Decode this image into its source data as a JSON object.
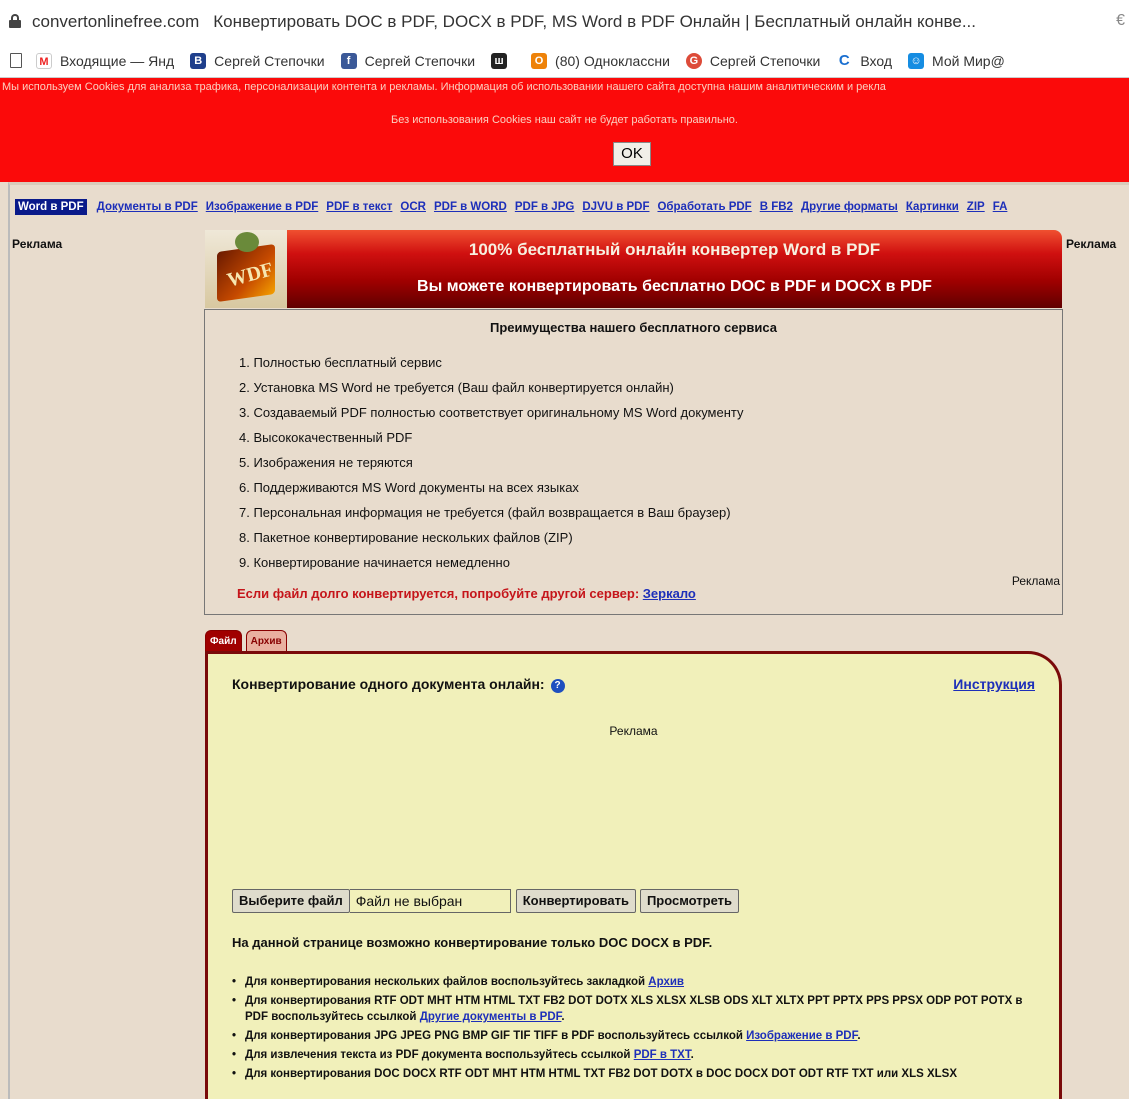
{
  "browser": {
    "domain": "convertonlinefree.com",
    "page_title": "Конвертировать DOC в PDF, DOCX в PDF, MS Word в PDF Онлайн | Бесплатный онлайн конве...",
    "edge_char": "€",
    "bookmarks": [
      {
        "label": "Входящие — Янд",
        "fade": "е",
        "icon": "mail-icon",
        "color": "#1a73e8"
      },
      {
        "label": "Сергей Степочки",
        "fade": "",
        "icon": "vk-icon",
        "color": "#1f3f8c"
      },
      {
        "label": "Сергей Степочки",
        "fade": "",
        "icon": "facebook-icon",
        "color": "#3b5998"
      },
      {
        "label": "(80) Одноклассни",
        "fade": "",
        "icon": "odnoklassniki-icon",
        "color": "#ee8208"
      },
      {
        "label": "Сергей Степочки",
        "fade": "",
        "icon": "gplus-icon",
        "color": "#dd4b39"
      },
      {
        "label": "Вход",
        "fade": "",
        "icon": "login-icon",
        "color": "#1a6fd0"
      },
      {
        "label": "Мой Мир@",
        "fade": "",
        "icon": "mymir-icon",
        "color": "#168de2"
      }
    ],
    "bookmark_glyphs": [
      "М",
      "В",
      "f",
      "ш",
      "О",
      "G",
      "С",
      "☺"
    ]
  },
  "cookie": {
    "line1": "Мы используем Cookies для анализа трафика, персонализации контента и рекламы. Информация об использовании нашего сайта доступна нашим аналитическим и рекла",
    "line2": "Без использования Cookies наш сайт не будет работать правильно.",
    "ok": "OK"
  },
  "nav": {
    "active": "Word в PDF",
    "links": [
      "Документы в PDF",
      "Изображение в PDF",
      "PDF в текст",
      "OCR",
      "PDF в WORD",
      "PDF в JPG",
      "DJVU в PDF",
      "Обработать PDF",
      "В FB2",
      "Другие форматы",
      "Картинки",
      "ZIP",
      "FA"
    ]
  },
  "reklama": "Реклама",
  "logo_text": "WDF",
  "banner": {
    "title": "100% бесплатный онлайн конвертер Word в PDF",
    "subtitle": "Вы можете конвертировать бесплатно DOC в PDF и DOCX в PDF"
  },
  "advantages": {
    "heading": "Преимущества нашего бесплатного сервиса",
    "items": [
      "1. Полностью бесплатный сервис",
      "2. Установка MS Word не требуется (Ваш файл конвертируется онлайн)",
      "3. Создаваемый PDF полностью соответствует оригинальному MS Word документу",
      "4. Высококачественный PDF",
      "5. Изображения не теряются",
      "6. Поддерживаются MS Word документы на всех языках",
      "7. Персональная информация не требуется (файл возвращается в Ваш браузер)",
      "8. Пакетное конвертирование нескольких файлов (ZIP)",
      "9. Конвертирование начинается немедленно"
    ],
    "mirror_text": "Если файл долго конвертируется, попробуйте другой сервер:",
    "mirror_link": "Зеркало",
    "reklama": "Реклама"
  },
  "tabs": [
    "Файл",
    "Архив"
  ],
  "panel": {
    "title": "Конвертирование одного документа онлайн:",
    "help_glyph": "?",
    "instructions": "Инструкция",
    "reklama": "Реклама",
    "choose_file": "Выберите файл",
    "no_file": "Файл не выбран",
    "convert": "Конвертировать",
    "preview": "Просмотреть",
    "note": "На данной странице возможно конвертирование только DOC DOCX в PDF.",
    "bullets": [
      {
        "pre": "Для конвертирования нескольких файлов воспользуйтесь закладкой ",
        "link": "Архив",
        "post": ""
      },
      {
        "pre": "Для конвертирования RTF ODT MHT HTM HTML TXT FB2 DOT DOTX XLS XLSX XLSB ODS XLT XLTX PPT PPTX PPS PPSX ODP POT POTX в PDF воспользуйтесь ссылкой ",
        "link": "Другие документы в PDF",
        "post": "."
      },
      {
        "pre": "Для конвертирования JPG JPEG PNG BMP GIF TIF TIFF в PDF воспользуйтесь ссылкой ",
        "link": "Изображение в PDF",
        "post": "."
      },
      {
        "pre": "Для извлечения текста из PDF документа воспользуйтесь ссылкой ",
        "link": "PDF в TXT",
        "post": "."
      },
      {
        "pre": "Для конвертирования DOC DOCX RTF ODT MHT HTM HTML TXT FB2 DOT DOTX в DOC DOCX DOT ODT RTF TXT или XLS XLSX",
        "link": "",
        "post": ""
      }
    ]
  }
}
